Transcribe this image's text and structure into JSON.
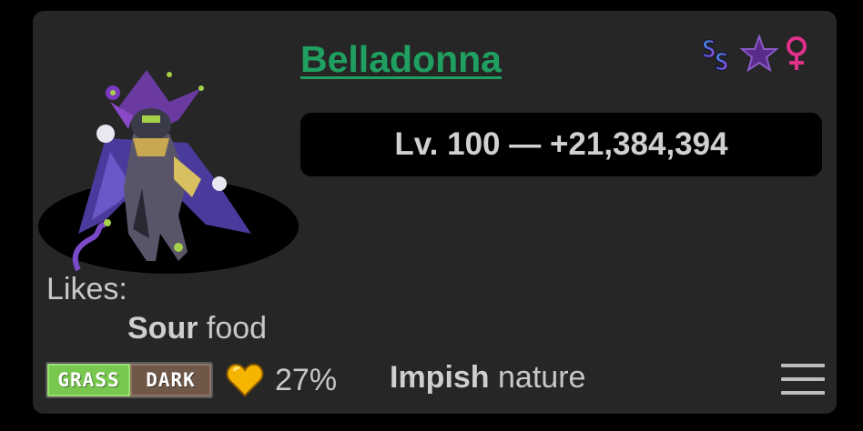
{
  "pokemon": {
    "name": "Belladonna",
    "level_text": "Lv. 100 — +21,384,394",
    "likes_label": "Likes:",
    "likes_flavor": "Sour",
    "likes_suffix": " food",
    "types": [
      "GRASS",
      "DARK"
    ],
    "friendship": "27%",
    "nature_name": "Impish",
    "nature_suffix": " nature",
    "gender_symbol": "♀"
  },
  "icons": {
    "sprite": "grimmsnarl-jester-sprite-icon",
    "shiny": "shiny-ss-icon",
    "star": "star-icon",
    "gender": "female-icon",
    "heart": "heart-icon",
    "menu": "hamburger-menu-icon"
  },
  "colors": {
    "card_bg": "#262626",
    "name": "#1fa061",
    "grass_type": "#78c850",
    "dark_type": "#705848",
    "heart": "#f5b400",
    "gender": "#e0308a",
    "star": "#5a2a88"
  }
}
